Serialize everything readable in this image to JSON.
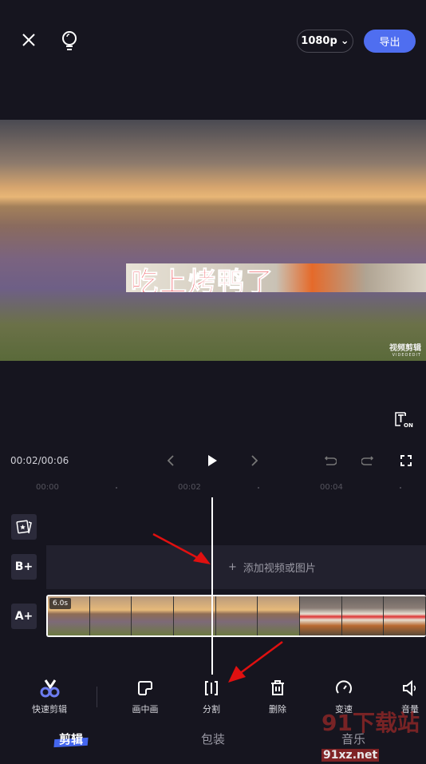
{
  "header": {
    "resolution": "1080p",
    "export_label": "导出"
  },
  "preview": {
    "sticker_text": "吃上烤鸭了",
    "watermark": "视频剪辑",
    "watermark_sub": "VIDEOEDIT",
    "subtitle_toggle": "ON"
  },
  "playback": {
    "time": "00:02/00:06"
  },
  "ruler": {
    "ticks": [
      "00:00",
      "00:02",
      "00:04"
    ]
  },
  "tracks": {
    "b_label": "B+",
    "a_label": "A+",
    "add_media": "添加视频或图片",
    "clip_duration": "6.0s"
  },
  "toolbar": {
    "items": [
      {
        "label": "快速剪辑",
        "icon": "quick-cut-icon"
      },
      {
        "label": "画中画",
        "icon": "pip-icon"
      },
      {
        "label": "分割",
        "icon": "split-icon"
      },
      {
        "label": "删除",
        "icon": "trash-icon"
      },
      {
        "label": "变速",
        "icon": "speed-icon"
      },
      {
        "label": "音量",
        "icon": "volume-icon"
      }
    ]
  },
  "tabs": [
    {
      "label": "剪辑",
      "active": true
    },
    {
      "label": "包装"
    },
    {
      "label": "音乐"
    }
  ],
  "overlay_watermark": {
    "text": "91下载站",
    "url_text": "91xz.net"
  },
  "colors": {
    "accent": "#4f6ef0",
    "background": "#16151f",
    "annotation_arrow": "#e01010"
  }
}
